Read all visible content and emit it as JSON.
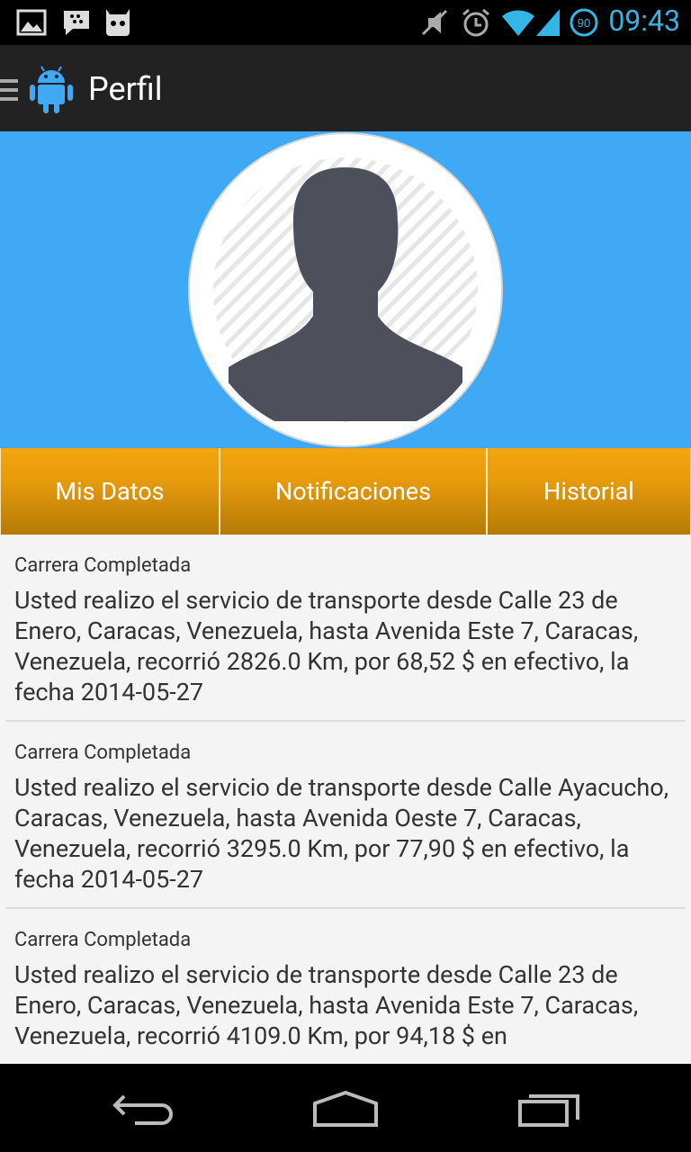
{
  "status_bar": {
    "time": "09:43",
    "battery": "90",
    "icons": [
      "image-icon",
      "bbm-icon",
      "cyanogen-icon",
      "mute-icon",
      "alarm-icon",
      "wifi-icon",
      "signal-icon",
      "battery-icon"
    ]
  },
  "action_bar": {
    "title": "Perfil",
    "icons": [
      "menu-icon",
      "android-icon"
    ]
  },
  "profile": {
    "avatar_icon": "user-silhouette-icon",
    "header_color": "#3fa9f5"
  },
  "tabs": [
    {
      "label": "Mis Datos"
    },
    {
      "label": "Notificaciones"
    },
    {
      "label": "Historial"
    }
  ],
  "notifications": [
    {
      "title": "Carrera Completada",
      "body": "Usted realizo el servicio de transporte desde Calle 23 de Enero, Caracas, Venezuela, hasta Avenida Este 7, Caracas, Venezuela, recorrió 2826.0 Km, por 68,52 $ en efectivo, la fecha 2014-05-27"
    },
    {
      "title": "Carrera Completada",
      "body": "Usted realizo el servicio de transporte desde Calle Ayacucho, Caracas, Venezuela, hasta Avenida Oeste 7, Caracas, Venezuela, recorrió 3295.0 Km, por 77,90 $ en efectivo, la fecha 2014-05-27"
    },
    {
      "title": "Carrera Completada",
      "body": "Usted realizo el servicio de transporte desde Calle 23 de Enero, Caracas, Venezuela, hasta Avenida Este 7, Caracas, Venezuela, recorrió 4109.0 Km, por 94,18 $ en"
    }
  ],
  "nav_bar": {
    "icons": [
      "back-icon",
      "home-icon",
      "recents-icon"
    ]
  },
  "colors": {
    "accent": "#33b5e5",
    "tab_orange": "#e59a0c"
  }
}
